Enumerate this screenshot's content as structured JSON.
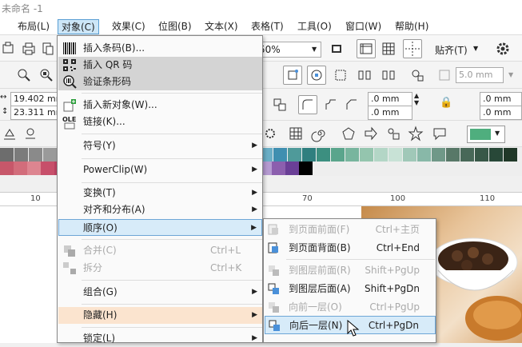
{
  "window": {
    "title": "未命名 -1"
  },
  "menubar": {
    "items": [
      "布局(L)",
      "对象(C)",
      "效果(C)",
      "位图(B)",
      "文本(X)",
      "表格(T)",
      "工具(O)",
      "窗口(W)",
      "帮助(H)"
    ]
  },
  "toolbar": {
    "zoom_value": "50%",
    "snap_label": "贴齐(T)",
    "outline_width": "5.0 mm",
    "pos_x": "19.402 mm",
    "pos_y": "23.311 mm",
    "corner_a": ".0 mm",
    "corner_b": ".0 mm",
    "corner_c": ".0 mm",
    "corner_d": ".0 mm",
    "fill_color": "#4fae7e"
  },
  "ruler": {
    "ticks": [
      "10",
      "70",
      "100",
      "110"
    ]
  },
  "object_menu": {
    "items": [
      {
        "label": "插入条码(B)...",
        "icon": "barcode-icon"
      },
      {
        "label": "插入 QR 码",
        "icon": "qr-code-icon"
      },
      {
        "label": "验证条形码",
        "icon": "verify-barcode-icon"
      },
      {
        "label": "插入新对象(W)...",
        "icon": "insert-object-icon"
      },
      {
        "label": "链接(K)...",
        "icon": "ole-link-icon"
      },
      {
        "label": "符号(Y)"
      },
      {
        "label": "PowerClip(W)"
      },
      {
        "label": "变换(T)"
      },
      {
        "label": "对齐和分布(A)"
      },
      {
        "label": "顺序(O)"
      },
      {
        "label": "合并(C)",
        "shortcut": "Ctrl+L",
        "icon": "combine-icon"
      },
      {
        "label": "拆分",
        "shortcut": "Ctrl+K",
        "icon": "break-apart-icon"
      },
      {
        "label": "组合(G)"
      },
      {
        "label": "隐藏(H)"
      },
      {
        "label": "锁定(L)"
      }
    ]
  },
  "order_menu": {
    "items": [
      {
        "label": "到页面前面(F)",
        "shortcut": "Ctrl+主页"
      },
      {
        "label": "到页面背面(B)",
        "shortcut": "Ctrl+End"
      },
      {
        "label": "到图层前面(R)",
        "shortcut": "Shift+PgUp"
      },
      {
        "label": "到图层后面(A)",
        "shortcut": "Shift+PgDn"
      },
      {
        "label": "向前一层(O)",
        "shortcut": "Ctrl+PgUp"
      },
      {
        "label": "向后一层(N)",
        "shortcut": "Ctrl+PgDn"
      }
    ]
  },
  "palette": {
    "row1": [
      "#6d6d6d",
      "#7b7b7b",
      "#8a8a8a",
      "#9a9a9a",
      "#aaaaaa",
      "#bcbcbc",
      "#cccccc",
      "#dadada",
      "#e6e6e6",
      "#cfcfcf",
      "#b9b9b9",
      "#5d6ea8",
      "#6c63a8",
      "#7e74b7",
      "#4b7fbd",
      "#5a97cf",
      "#7db6df",
      "#9fd1ef",
      "#6aaec6",
      "#3f8fb0",
      "#4f9a9a",
      "#2f7f7f",
      "#3c8f80",
      "#5aa58c",
      "#78b59e",
      "#94c5ae",
      "#b3d6c6",
      "#c8e2d6",
      "#a0c8b8",
      "#88b8a8",
      "#709888",
      "#587868",
      "#486858",
      "#385848",
      "#284838",
      "#203828"
    ],
    "row2": [
      "#c7576a",
      "#d26d7b",
      "#dd8590",
      "#c74f6a",
      "#b84262",
      "#a83a5b",
      "#9a3254",
      "#ffffff",
      "#ffffff",
      "#ffffff",
      "#ffffff",
      "#ffffff",
      "#ffffff",
      "#ffffff",
      "#ffffff",
      "#ffffff",
      "#ffffff",
      "#e9e9e9",
      "#d6c6e6",
      "#b59ad1",
      "#8c5fae",
      "#6a3f96",
      "#000000"
    ]
  }
}
